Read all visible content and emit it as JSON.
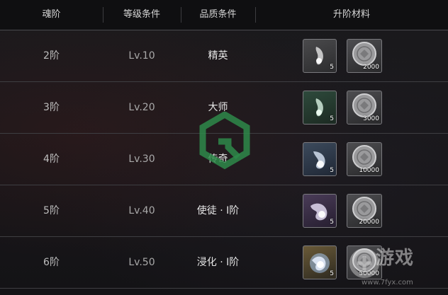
{
  "header": {
    "col_tier": "魂阶",
    "col_level": "等级条件",
    "col_quality": "品质条件",
    "col_materials": "升阶材料"
  },
  "rows": [
    {
      "tier": "2阶",
      "level": "Lv.10",
      "quality": "精英",
      "soul_qty": "5",
      "coin_qty": "2000"
    },
    {
      "tier": "3阶",
      "level": "Lv.20",
      "quality": "大师",
      "soul_qty": "5",
      "coin_qty": "3000"
    },
    {
      "tier": "4阶",
      "level": "Lv.30",
      "quality": "传奇",
      "soul_qty": "5",
      "coin_qty": "10000"
    },
    {
      "tier": "5阶",
      "level": "Lv.40",
      "quality": "使徒 · Ⅰ阶",
      "soul_qty": "5",
      "coin_qty": "20000"
    },
    {
      "tier": "6阶",
      "level": "Lv.50",
      "quality": "浸化 · Ⅰ阶",
      "soul_qty": "5",
      "coin_qty": "50000"
    }
  ],
  "icons": {
    "soul": "soul-wisp-icon",
    "coin": "silver-coin-icon",
    "watermark": "site-logo-icon"
  },
  "colors": {
    "header_bg": "#0f0f11",
    "row_border": "#3e3e42",
    "watermark_green": "#2e8a4a"
  },
  "watermark": {
    "brand": "游戏",
    "url": "www.7fyx.com"
  }
}
